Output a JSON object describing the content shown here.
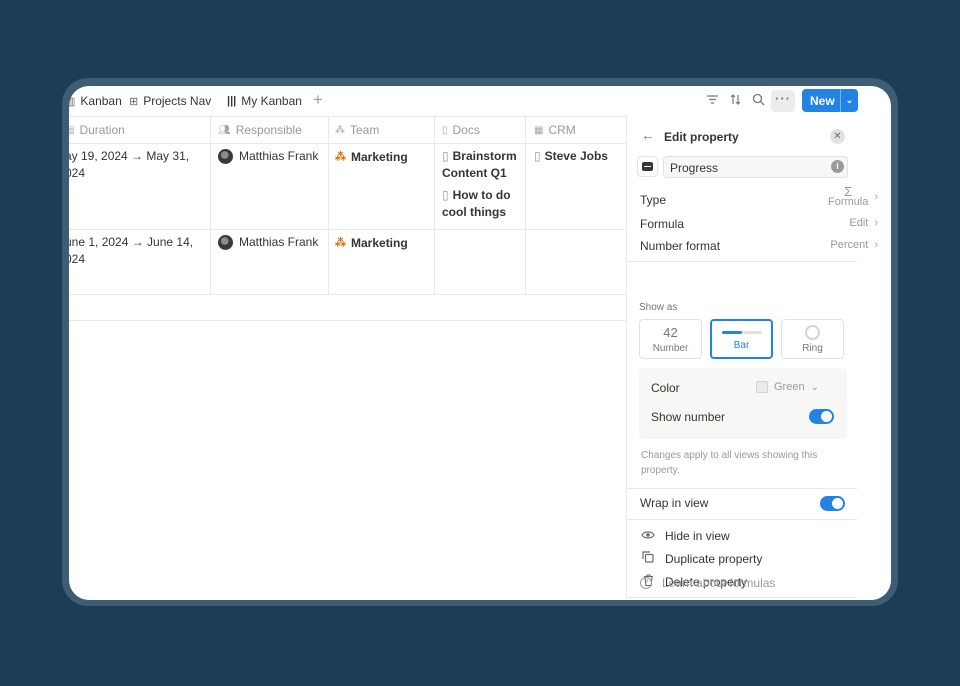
{
  "toolbar": {
    "tabs": [
      {
        "label": "Kanban",
        "icon": "board-icon"
      },
      {
        "label": "Projects Nav",
        "icon": "gallery-icon"
      },
      {
        "label": "My Kanban",
        "icon": "board-icon"
      }
    ],
    "add_symbol": "+",
    "more_symbol": "···",
    "new_label": "New",
    "accent": "#2383e2"
  },
  "table": {
    "columns": [
      {
        "label": "Duration",
        "icon": "calendar-icon"
      },
      {
        "label": "Responsible",
        "icon": "people-icon"
      },
      {
        "label": "Team",
        "icon": "team-icon"
      },
      {
        "label": "Docs",
        "icon": "doc-icon"
      },
      {
        "label": "CRM",
        "icon": "crm-icon"
      }
    ],
    "rows": [
      {
        "duration_l1": "ay 19, 2024 → May 31,",
        "duration_l2": "024",
        "responsible": "Matthias Frank",
        "team": "Marketing",
        "doc1": "Brainstorm Content Q1",
        "doc2": "How to do cool things",
        "crm": "Steve Jobs"
      },
      {
        "duration_l1": "une 1, 2024 → June 14,",
        "duration_l2": "024",
        "responsible": "Matthias Frank",
        "team": "Marketing"
      }
    ]
  },
  "panel": {
    "title": "Edit property",
    "name_value": "Progress",
    "type_label": "Type",
    "type_symbol": "Σ",
    "type_value": "Formula",
    "formula_label": "Formula",
    "formula_value": "Edit",
    "number_format_label": "Number format",
    "number_format_value": "Percent",
    "show_as_label": "Show as",
    "options": [
      {
        "big": "42",
        "label": "Number"
      },
      {
        "label": "Bar",
        "fill_fraction": 0.5
      },
      {
        "label": "Ring"
      }
    ],
    "selected_option": "Bar",
    "color_label": "Color",
    "color_value": "Green",
    "show_number_label": "Show number",
    "show_number_on": true,
    "note": "Changes apply to all views showing this property.",
    "wrap_label": "Wrap in view",
    "wrap_on": true,
    "actions": [
      {
        "label": "Hide in view",
        "icon": "eye-icon"
      },
      {
        "label": "Duplicate property",
        "icon": "copy-icon"
      },
      {
        "label": "Delete property",
        "icon": "trash-icon"
      }
    ],
    "learn_label": "Learn about formulas"
  },
  "colors": {
    "background": "#1d3d57",
    "accent": "#2383e2",
    "team_icon": "#d9730d"
  }
}
